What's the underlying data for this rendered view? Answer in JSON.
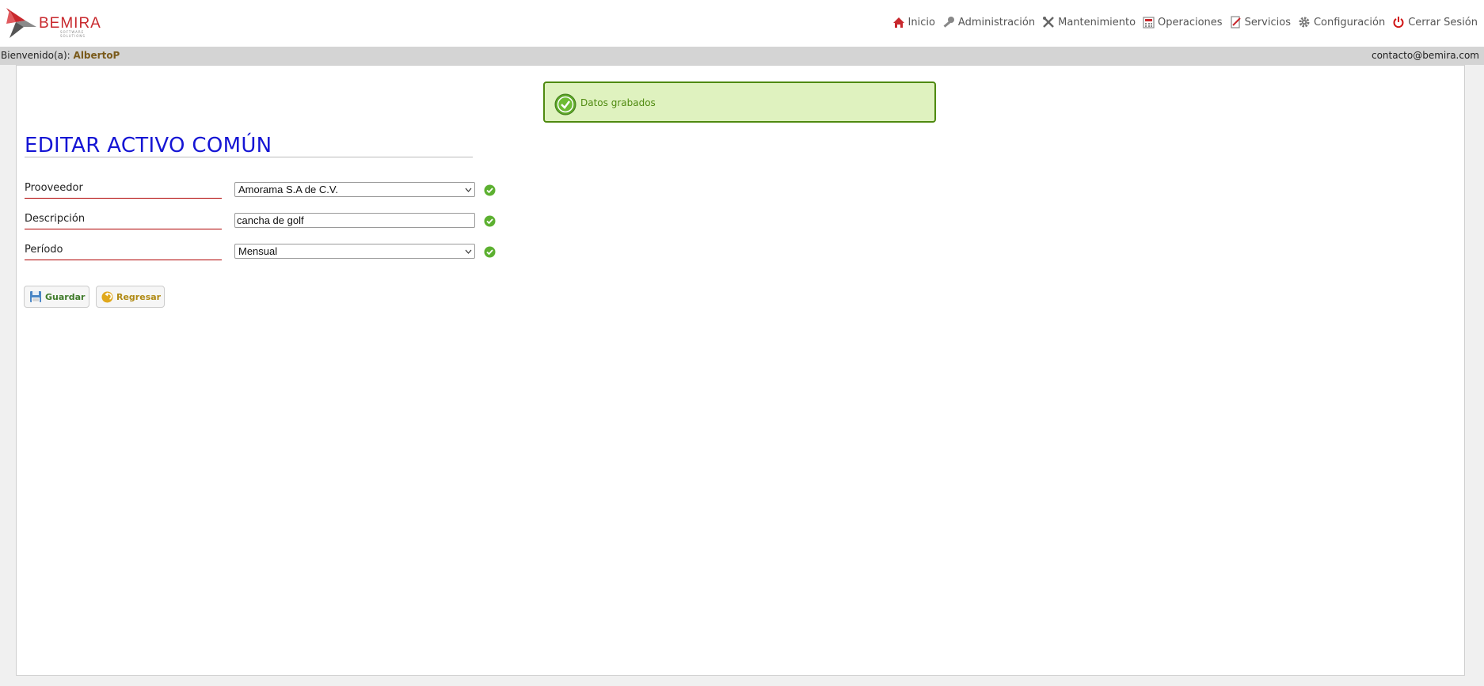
{
  "brand": {
    "name": "BEMIRA",
    "tagline": "SOFTWARE SOLUTIONS"
  },
  "nav": [
    {
      "label": "Inicio",
      "icon": "home-icon"
    },
    {
      "label": "Administración",
      "icon": "key-icon"
    },
    {
      "label": "Mantenimiento",
      "icon": "tools-icon"
    },
    {
      "label": "Operaciones",
      "icon": "calculator-icon"
    },
    {
      "label": "Servicios",
      "icon": "document-edit-icon"
    },
    {
      "label": "Configuración",
      "icon": "gear-icon"
    },
    {
      "label": "Cerrar Sesión",
      "icon": "power-icon"
    }
  ],
  "welcome": {
    "prefix": "Bienvenido(a):",
    "user": "AlbertoP",
    "contact": "contacto@bemira.com"
  },
  "alert": {
    "message": "Datos grabados",
    "icon": "check-circle-icon",
    "color": "#4f8a10"
  },
  "page": {
    "title": "EDITAR ACTIVO COMÚN"
  },
  "form": {
    "proveedor": {
      "label": "Prooveedor",
      "value": "Amorama S.A de C.V."
    },
    "descripcion": {
      "label": "Descripción",
      "value": "cancha de golf"
    },
    "periodo": {
      "label": "Período",
      "value": "Mensual"
    }
  },
  "buttons": {
    "save": "Guardar",
    "back": "Regresar"
  },
  "colors": {
    "title": "#1515d4",
    "accent": "#c8282d",
    "label_rule": "#b00000"
  }
}
